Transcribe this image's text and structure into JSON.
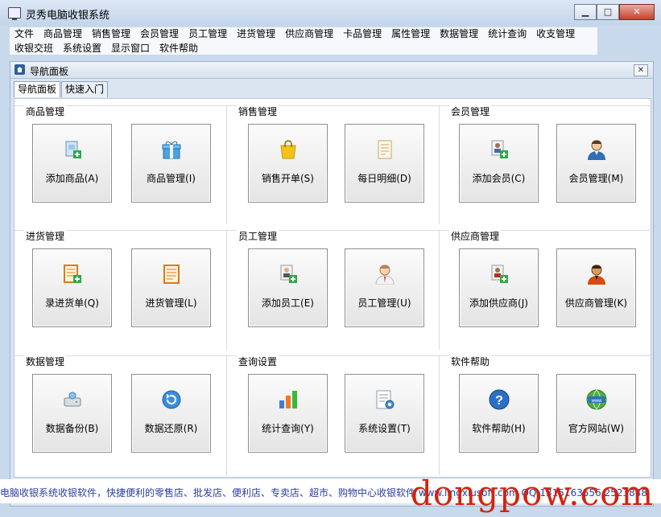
{
  "window": {
    "title": "灵秀电脑收银系统"
  },
  "menu": {
    "row1": [
      "文件",
      "商品管理",
      "销售管理",
      "会员管理",
      "员工管理",
      "进货管理",
      "供应商管理",
      "卡品管理",
      "属性管理",
      "数据管理",
      "统计查询",
      "收支管理"
    ],
    "row2": [
      "收银交班",
      "系统设置",
      "显示窗口",
      "软件帮助"
    ]
  },
  "panel": {
    "title": "导航面板"
  },
  "tabs": [
    "导航面板",
    "快速入门"
  ],
  "groups": [
    {
      "title": "商品管理",
      "tiles": [
        {
          "label": "添加商品(A)",
          "icon": "add-product-icon"
        },
        {
          "label": "商品管理(I)",
          "icon": "gift-box-icon"
        }
      ]
    },
    {
      "title": "销售管理",
      "tiles": [
        {
          "label": "销售开单(S)",
          "icon": "shopping-bag-icon"
        },
        {
          "label": "每日明细(D)",
          "icon": "receipt-icon"
        }
      ]
    },
    {
      "title": "会员管理",
      "tiles": [
        {
          "label": "添加会员(C)",
          "icon": "add-member-icon"
        },
        {
          "label": "会员管理(M)",
          "icon": "member-avatar-icon"
        }
      ]
    },
    {
      "title": "进货管理",
      "tiles": [
        {
          "label": "录进货单(Q)",
          "icon": "add-document-icon"
        },
        {
          "label": "进货管理(L)",
          "icon": "document-list-icon"
        }
      ]
    },
    {
      "title": "员工管理",
      "tiles": [
        {
          "label": "添加员工(E)",
          "icon": "add-employee-icon"
        },
        {
          "label": "员工管理(U)",
          "icon": "employee-avatar-icon"
        }
      ]
    },
    {
      "title": "供应商管理",
      "tiles": [
        {
          "label": "添加供应商(J)",
          "icon": "add-supplier-icon"
        },
        {
          "label": "供应商管理(K)",
          "icon": "supplier-avatar-icon"
        }
      ]
    },
    {
      "title": "数据管理",
      "tiles": [
        {
          "label": "数据备份(B)",
          "icon": "backup-drive-icon"
        },
        {
          "label": "数据还原(R)",
          "icon": "restore-icon"
        }
      ]
    },
    {
      "title": "查询设置",
      "tiles": [
        {
          "label": "统计查询(Y)",
          "icon": "bar-chart-icon"
        },
        {
          "label": "系统设置(T)",
          "icon": "settings-document-icon"
        }
      ]
    },
    {
      "title": "软件帮助",
      "tiles": [
        {
          "label": "软件帮助(H)",
          "icon": "help-icon"
        },
        {
          "label": "官方网站(W)",
          "icon": "globe-www-icon"
        }
      ]
    }
  ],
  "status": {
    "marquee": "电脑收银系统收银软件，快捷便利的零售店、批发店、便利店、专卖店、超市、购物中心收银软件 www.lingxiusoft.com QQ:1315163556 2523848"
  },
  "watermark": {
    "text": "dongpow.com"
  }
}
